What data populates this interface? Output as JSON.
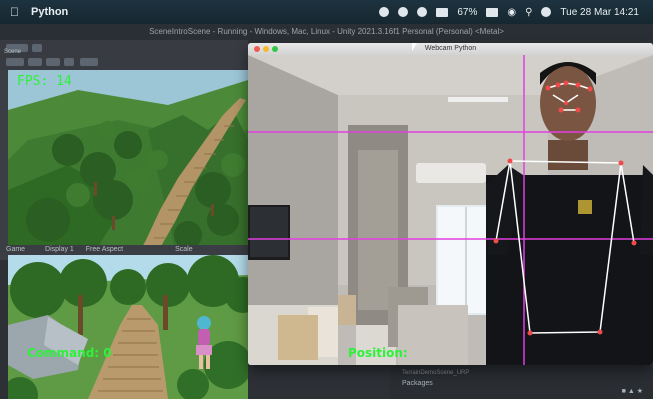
{
  "menubar": {
    "app_name": "Python",
    "date_time": "Tue 28 Mar 14:21",
    "battery": "67%"
  },
  "unity": {
    "title": "SceneIntroScene - Running - Windows, Mac, Linux - Unity 2021.3.16f1 Personal (Personal) <Metal>",
    "scene_tab": "Scene",
    "game_tab": "Game",
    "display": "Display 1",
    "aspect": "Free Aspect",
    "scale_label": "Scale",
    "project_item": "TerrainDemoScene_URP",
    "packages_label": "Packages"
  },
  "webcam": {
    "window_title": "Webcam Python",
    "fps_label": "FPS: 14",
    "command_label": "Command: 0",
    "position_label": "Position:"
  },
  "colors": {
    "overlay_text": "#2df23a",
    "guide_lines": "#e23fe0",
    "skeleton": "#ffffff",
    "joints": "#f04a4a"
  }
}
